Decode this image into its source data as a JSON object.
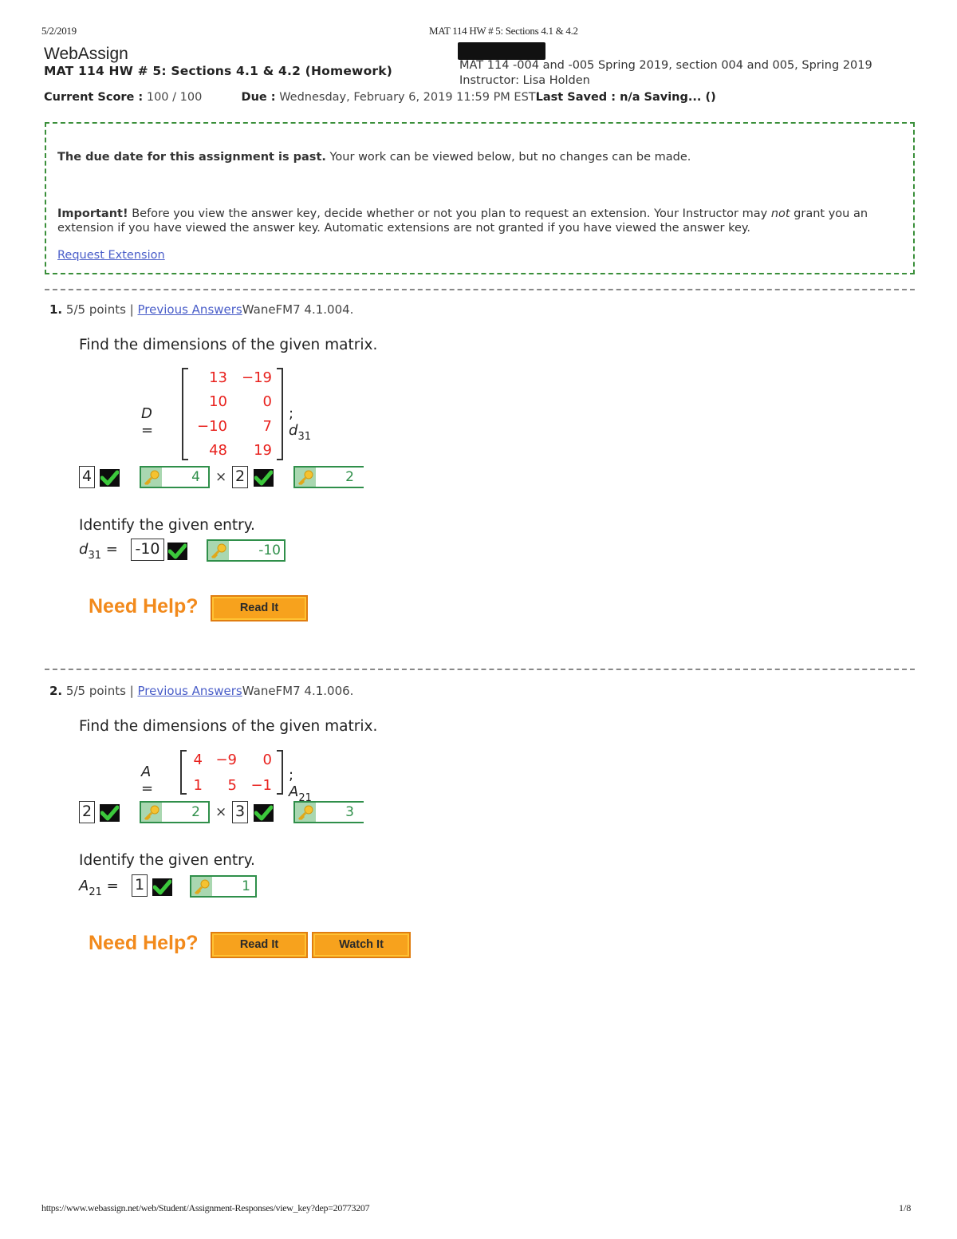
{
  "print": {
    "date": "5/2/2019",
    "title": "MAT 114 HW # 5: Sections 4.1 & 4.2",
    "url": "https://www.webassign.net/web/Student/Assignment-Responses/view_key?dep=20773207",
    "page": "1/8"
  },
  "header": {
    "brand": "WebAssign",
    "assignment_title": "MAT 114 HW # 5: Sections 4.1 & 4.2 (Homework)",
    "course": "MAT 114 -004 and -005 Spring 2019, section 004 and 005, Spring 2019",
    "instructor": "Instructor: Lisa Holden",
    "score_label": "Current Score :",
    "score_value": "100 / 100",
    "due_label": "Due :",
    "due_value": "Wednesday, February 6, 2019 11:59 PM EST",
    "saved_label": "Last Saved : n/a Saving...  ()"
  },
  "notice": {
    "past_bold": "The due date for this assignment is past.",
    "past_text": " Your work can be viewed below, but no changes can be made.",
    "important_bold": "Important!",
    "important_text_1": " Before you view the answer key, decide whether or not you plan to request an extension. Your Instructor may ",
    "important_em": "not",
    "important_text_2": " grant you an extension if you have viewed the answer key. Automatic extensions are not granted if you have viewed the answer key.",
    "request_link": "Request Extension"
  },
  "questions": [
    {
      "number": "1.",
      "points": "5/5 points |",
      "prev_link": "Previous Answers",
      "source": "WaneFM7 4.1.004.",
      "prompt": "Find the dimensions of the given matrix.",
      "matrix_name": "D =",
      "matrix": [
        [
          "13",
          "−19"
        ],
        [
          "10",
          "0"
        ],
        [
          "−10",
          "7"
        ],
        [
          "48",
          "19"
        ]
      ],
      "entry_label": "d",
      "entry_sub": "31",
      "rows_answer": "4",
      "rows_key": "4",
      "cols_answer": "2",
      "cols_key": "2",
      "identify_prompt": "Identify the given entry.",
      "entry_answer": "-10",
      "entry_key": "-10",
      "need_help": "Need Help?",
      "help_buttons": [
        "Read It"
      ]
    },
    {
      "number": "2.",
      "points": "5/5 points |",
      "prev_link": "Previous Answers",
      "source": "WaneFM7 4.1.006.",
      "prompt": "Find the dimensions of the given matrix.",
      "matrix_name": "A =",
      "matrix": [
        [
          "4",
          "−9",
          "0"
        ],
        [
          "1",
          "5",
          "−1"
        ]
      ],
      "entry_label": "A",
      "entry_sub": "21",
      "rows_answer": "2",
      "rows_key": "2",
      "cols_answer": "3",
      "cols_key": "3",
      "identify_prompt": "Identify the given entry.",
      "entry_answer": "1",
      "entry_key": "1",
      "need_help": "Need Help?",
      "help_buttons": [
        "Read It",
        "Watch It"
      ]
    }
  ],
  "symbols": {
    "times": "×",
    "equals": "=",
    "semicolon": ";"
  },
  "icons": {
    "correct": "check-icon",
    "answer_key": "key-icon"
  }
}
